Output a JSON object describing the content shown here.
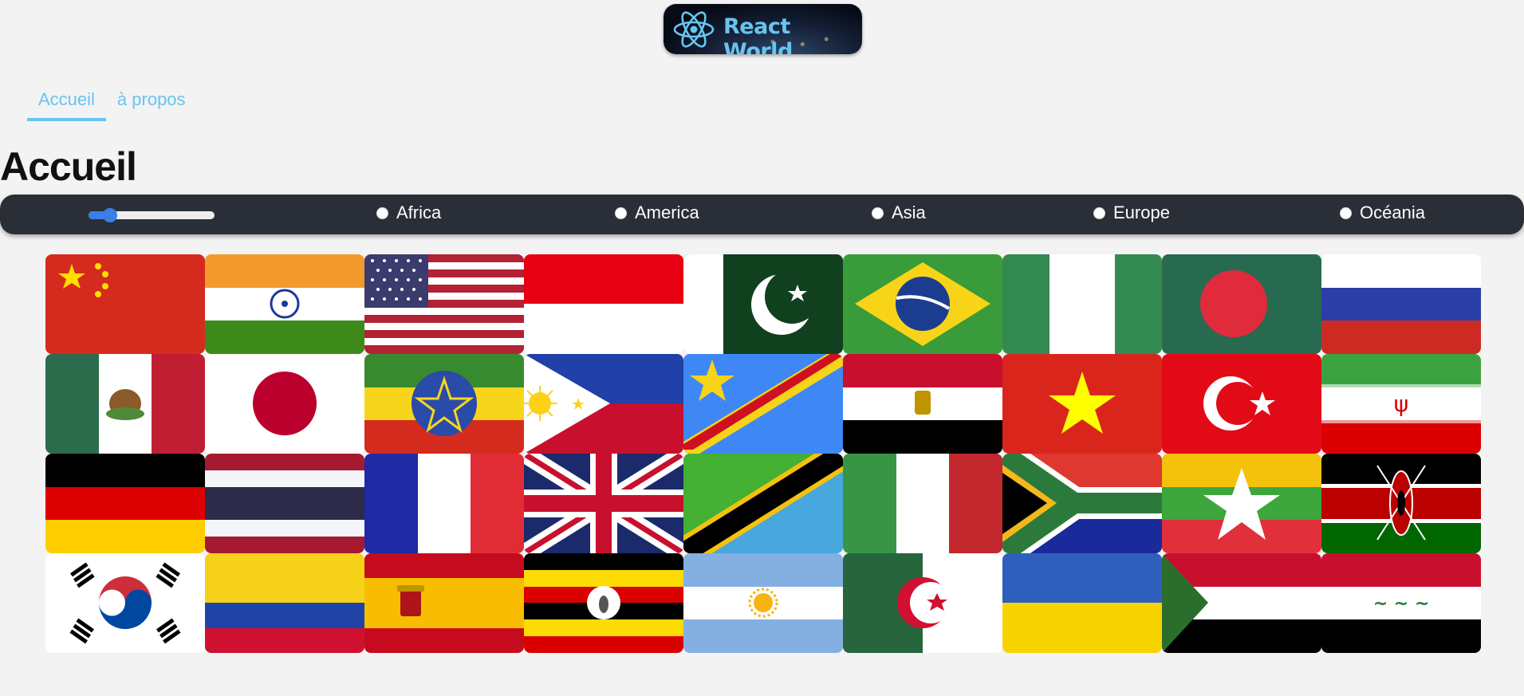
{
  "header": {
    "logo_text": "React World"
  },
  "nav": {
    "items": [
      {
        "label": "Accueil",
        "active": true
      },
      {
        "label": "à propos",
        "active": false
      }
    ]
  },
  "page": {
    "title": "Accueil"
  },
  "filters": {
    "slider_value_fraction": 0.17,
    "regions": [
      "Africa",
      "America",
      "Asia",
      "Europe",
      "Océania"
    ]
  },
  "colors": {
    "accent": "#67c5ef",
    "bar_background": "#2a2e36",
    "slider": "#3a7ee8",
    "page_background": "#f3f3f3"
  },
  "flags": [
    {
      "name": "china-flag"
    },
    {
      "name": "india-flag"
    },
    {
      "name": "usa-flag"
    },
    {
      "name": "indonesia-flag"
    },
    {
      "name": "pakistan-flag"
    },
    {
      "name": "brazil-flag"
    },
    {
      "name": "nigeria-flag"
    },
    {
      "name": "bangladesh-flag"
    },
    {
      "name": "russia-flag"
    },
    {
      "name": "mexico-flag"
    },
    {
      "name": "japan-flag"
    },
    {
      "name": "ethiopia-flag"
    },
    {
      "name": "philippines-flag"
    },
    {
      "name": "dr-congo-flag"
    },
    {
      "name": "egypt-flag"
    },
    {
      "name": "vietnam-flag"
    },
    {
      "name": "turkey-flag"
    },
    {
      "name": "iran-flag"
    },
    {
      "name": "germany-flag"
    },
    {
      "name": "thailand-flag"
    },
    {
      "name": "france-flag"
    },
    {
      "name": "united-kingdom-flag"
    },
    {
      "name": "tanzania-flag"
    },
    {
      "name": "italy-flag"
    },
    {
      "name": "south-africa-flag"
    },
    {
      "name": "myanmar-flag"
    },
    {
      "name": "kenya-flag"
    },
    {
      "name": "south-korea-flag"
    },
    {
      "name": "colombia-flag"
    },
    {
      "name": "spain-flag"
    },
    {
      "name": "uganda-flag"
    },
    {
      "name": "argentina-flag"
    },
    {
      "name": "algeria-flag"
    },
    {
      "name": "ukraine-flag"
    },
    {
      "name": "sudan-flag"
    },
    {
      "name": "iraq-flag"
    }
  ]
}
